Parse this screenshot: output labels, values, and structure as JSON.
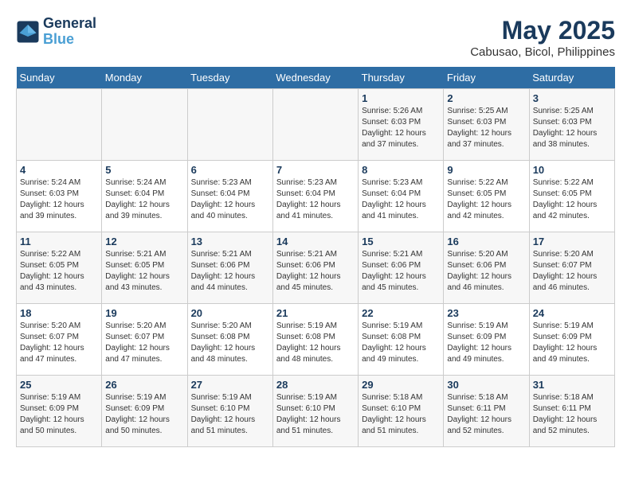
{
  "header": {
    "logo_line1": "General",
    "logo_line2": "Blue",
    "month_year": "May 2025",
    "location": "Cabusao, Bicol, Philippines"
  },
  "days_of_week": [
    "Sunday",
    "Monday",
    "Tuesday",
    "Wednesday",
    "Thursday",
    "Friday",
    "Saturday"
  ],
  "weeks": [
    [
      {
        "day": "",
        "info": ""
      },
      {
        "day": "",
        "info": ""
      },
      {
        "day": "",
        "info": ""
      },
      {
        "day": "",
        "info": ""
      },
      {
        "day": "1",
        "info": "Sunrise: 5:26 AM\nSunset: 6:03 PM\nDaylight: 12 hours\nand 37 minutes."
      },
      {
        "day": "2",
        "info": "Sunrise: 5:25 AM\nSunset: 6:03 PM\nDaylight: 12 hours\nand 37 minutes."
      },
      {
        "day": "3",
        "info": "Sunrise: 5:25 AM\nSunset: 6:03 PM\nDaylight: 12 hours\nand 38 minutes."
      }
    ],
    [
      {
        "day": "4",
        "info": "Sunrise: 5:24 AM\nSunset: 6:03 PM\nDaylight: 12 hours\nand 39 minutes."
      },
      {
        "day": "5",
        "info": "Sunrise: 5:24 AM\nSunset: 6:04 PM\nDaylight: 12 hours\nand 39 minutes."
      },
      {
        "day": "6",
        "info": "Sunrise: 5:23 AM\nSunset: 6:04 PM\nDaylight: 12 hours\nand 40 minutes."
      },
      {
        "day": "7",
        "info": "Sunrise: 5:23 AM\nSunset: 6:04 PM\nDaylight: 12 hours\nand 41 minutes."
      },
      {
        "day": "8",
        "info": "Sunrise: 5:23 AM\nSunset: 6:04 PM\nDaylight: 12 hours\nand 41 minutes."
      },
      {
        "day": "9",
        "info": "Sunrise: 5:22 AM\nSunset: 6:05 PM\nDaylight: 12 hours\nand 42 minutes."
      },
      {
        "day": "10",
        "info": "Sunrise: 5:22 AM\nSunset: 6:05 PM\nDaylight: 12 hours\nand 42 minutes."
      }
    ],
    [
      {
        "day": "11",
        "info": "Sunrise: 5:22 AM\nSunset: 6:05 PM\nDaylight: 12 hours\nand 43 minutes."
      },
      {
        "day": "12",
        "info": "Sunrise: 5:21 AM\nSunset: 6:05 PM\nDaylight: 12 hours\nand 43 minutes."
      },
      {
        "day": "13",
        "info": "Sunrise: 5:21 AM\nSunset: 6:06 PM\nDaylight: 12 hours\nand 44 minutes."
      },
      {
        "day": "14",
        "info": "Sunrise: 5:21 AM\nSunset: 6:06 PM\nDaylight: 12 hours\nand 45 minutes."
      },
      {
        "day": "15",
        "info": "Sunrise: 5:21 AM\nSunset: 6:06 PM\nDaylight: 12 hours\nand 45 minutes."
      },
      {
        "day": "16",
        "info": "Sunrise: 5:20 AM\nSunset: 6:06 PM\nDaylight: 12 hours\nand 46 minutes."
      },
      {
        "day": "17",
        "info": "Sunrise: 5:20 AM\nSunset: 6:07 PM\nDaylight: 12 hours\nand 46 minutes."
      }
    ],
    [
      {
        "day": "18",
        "info": "Sunrise: 5:20 AM\nSunset: 6:07 PM\nDaylight: 12 hours\nand 47 minutes."
      },
      {
        "day": "19",
        "info": "Sunrise: 5:20 AM\nSunset: 6:07 PM\nDaylight: 12 hours\nand 47 minutes."
      },
      {
        "day": "20",
        "info": "Sunrise: 5:20 AM\nSunset: 6:08 PM\nDaylight: 12 hours\nand 48 minutes."
      },
      {
        "day": "21",
        "info": "Sunrise: 5:19 AM\nSunset: 6:08 PM\nDaylight: 12 hours\nand 48 minutes."
      },
      {
        "day": "22",
        "info": "Sunrise: 5:19 AM\nSunset: 6:08 PM\nDaylight: 12 hours\nand 49 minutes."
      },
      {
        "day": "23",
        "info": "Sunrise: 5:19 AM\nSunset: 6:09 PM\nDaylight: 12 hours\nand 49 minutes."
      },
      {
        "day": "24",
        "info": "Sunrise: 5:19 AM\nSunset: 6:09 PM\nDaylight: 12 hours\nand 49 minutes."
      }
    ],
    [
      {
        "day": "25",
        "info": "Sunrise: 5:19 AM\nSunset: 6:09 PM\nDaylight: 12 hours\nand 50 minutes."
      },
      {
        "day": "26",
        "info": "Sunrise: 5:19 AM\nSunset: 6:09 PM\nDaylight: 12 hours\nand 50 minutes."
      },
      {
        "day": "27",
        "info": "Sunrise: 5:19 AM\nSunset: 6:10 PM\nDaylight: 12 hours\nand 51 minutes."
      },
      {
        "day": "28",
        "info": "Sunrise: 5:19 AM\nSunset: 6:10 PM\nDaylight: 12 hours\nand 51 minutes."
      },
      {
        "day": "29",
        "info": "Sunrise: 5:18 AM\nSunset: 6:10 PM\nDaylight: 12 hours\nand 51 minutes."
      },
      {
        "day": "30",
        "info": "Sunrise: 5:18 AM\nSunset: 6:11 PM\nDaylight: 12 hours\nand 52 minutes."
      },
      {
        "day": "31",
        "info": "Sunrise: 5:18 AM\nSunset: 6:11 PM\nDaylight: 12 hours\nand 52 minutes."
      }
    ]
  ]
}
